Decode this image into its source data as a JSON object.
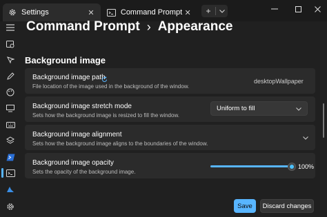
{
  "tabs": [
    {
      "label": "Settings",
      "icon": "gear-icon",
      "active": true
    },
    {
      "label": "Command Prompt",
      "icon": "terminal-icon",
      "active": false
    }
  ],
  "breadcrumb": {
    "parent": "Command Prompt",
    "separator": "›",
    "current": "Appearance"
  },
  "section": {
    "heading": "Background image"
  },
  "settings": {
    "path": {
      "title": "Background image path",
      "description": "File location of the image used in the background of the window.",
      "value": "desktopWallpaper"
    },
    "stretch": {
      "title": "Background image stretch mode",
      "description": "Sets how the background image is resized to fill the window.",
      "value": "Uniform to fill"
    },
    "alignment": {
      "title": "Background image alignment",
      "description": "Sets how the background image aligns to the boundaries of the window."
    },
    "opacity": {
      "title": "Background image opacity",
      "description": "Sets the opacity of the background image.",
      "value": "100%",
      "level_percent": 100
    }
  },
  "footer": {
    "save_label": "Save",
    "discard_label": "Discard changes"
  },
  "colors": {
    "accent": "#58b5ff",
    "background": "#202020",
    "card": "#2b2b2b"
  }
}
